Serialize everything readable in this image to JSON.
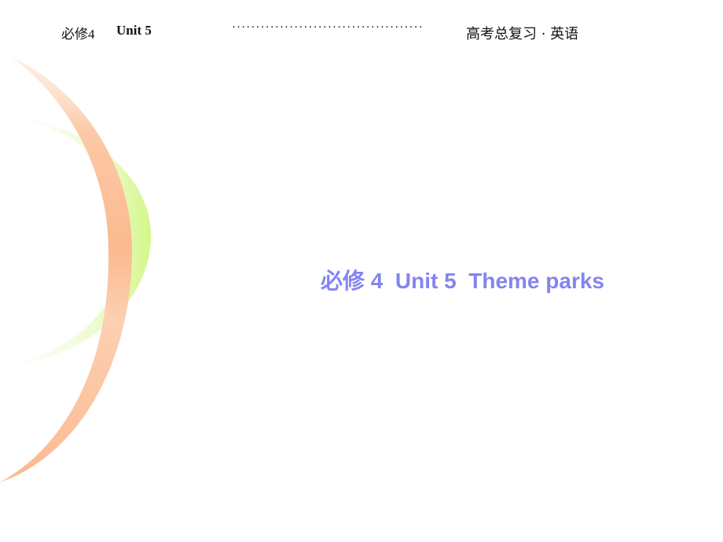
{
  "header": {
    "course": "必修4",
    "unit": "Unit  5",
    "leader_dots": "········································",
    "series": "高考总复习 · 英语"
  },
  "slide": {
    "title": "必修 4  Unit 5  Theme parks"
  },
  "colors": {
    "title": "#8484f0",
    "orange_arc": "#fcb98e",
    "green_arc": "#d8f890",
    "header_text": "#111111"
  }
}
